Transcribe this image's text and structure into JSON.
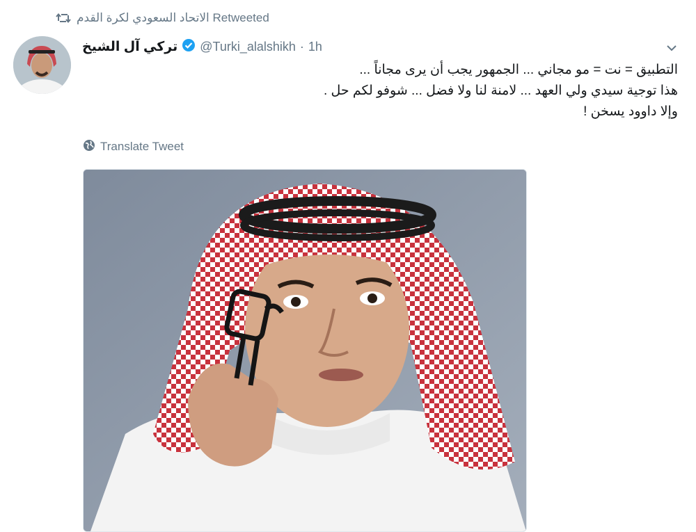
{
  "retweet": {
    "icon": "retweet-icon",
    "text": "الاتحاد السعودي لكرة القدم Retweeted"
  },
  "author": {
    "display_name": "تركي آل الشيخ",
    "verified_icon": "verified-badge-icon",
    "handle": "@Turki_alalshikh",
    "separator": "·",
    "time": "1h"
  },
  "tweet": {
    "lines": [
      "التطبيق = نت = مو مجاني ... الجمهور يجب أن يرى مجاناً ...",
      "هذا توجية سيدي ولي العهد ... لامنة لنا ولا فضل ... شوفو لكم حل .",
      "وإلا داوود يسخن !"
    ]
  },
  "translate": {
    "icon": "globe-icon",
    "label": "Translate Tweet"
  },
  "menu": {
    "icon": "chevron-down-icon"
  },
  "colors": {
    "verified": "#1da1f2",
    "muted": "#657786",
    "text": "#14171a"
  }
}
